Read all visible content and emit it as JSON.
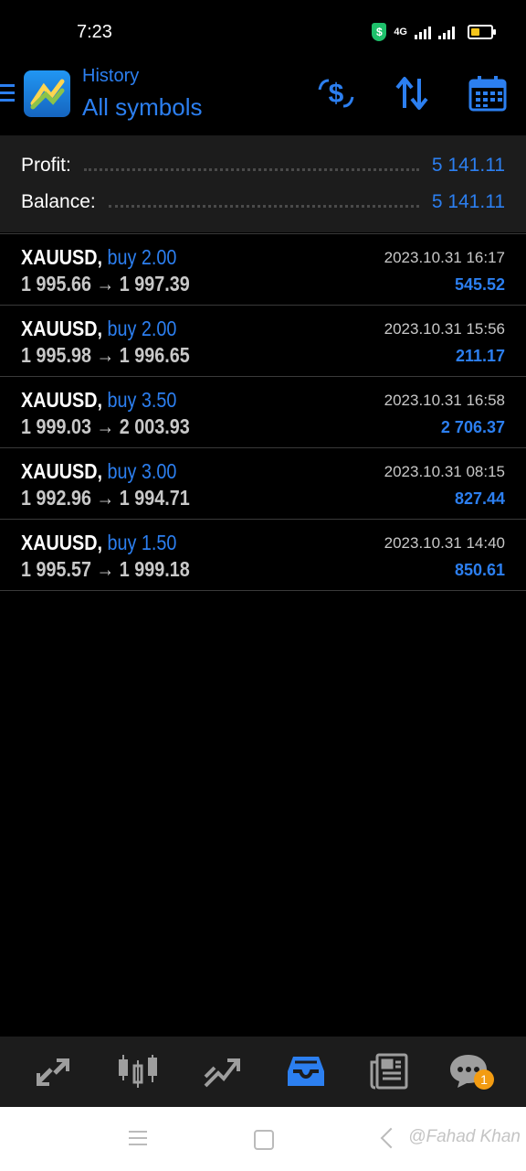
{
  "status_bar": {
    "time": "7:23",
    "network": "4G"
  },
  "header": {
    "title": "History",
    "subtitle": "All symbols"
  },
  "summary": {
    "profit_label": "Profit:",
    "profit_value": "5 141.11",
    "balance_label": "Balance:",
    "balance_value": "5 141.11"
  },
  "deals": [
    {
      "symbol": "XAUUSD,",
      "side": "buy 2.00",
      "open": "1 995.66",
      "close": "1 997.39",
      "time": "2023.10.31 16:17",
      "profit": "545.52"
    },
    {
      "symbol": "XAUUSD,",
      "side": "buy 2.00",
      "open": "1 995.98",
      "close": "1 996.65",
      "time": "2023.10.31 15:56",
      "profit": "211.17"
    },
    {
      "symbol": "XAUUSD,",
      "side": "buy 3.50",
      "open": "1 999.03",
      "close": "2 003.93",
      "time": "2023.10.31 16:58",
      "profit": "2 706.37"
    },
    {
      "symbol": "XAUUSD,",
      "side": "buy 3.00",
      "open": "1 992.96",
      "close": "1 994.71",
      "time": "2023.10.31 08:15",
      "profit": "827.44"
    },
    {
      "symbol": "XAUUSD,",
      "side": "buy 1.50",
      "open": "1 995.57",
      "close": "1 999.18",
      "time": "2023.10.31 14:40",
      "profit": "850.61"
    }
  ],
  "arrow": "→",
  "bottom_nav": {
    "chat_badge": "1"
  },
  "watermark": "@Fahad Khan",
  "colors": {
    "accent": "#2c7ff0",
    "background": "#000000",
    "panel": "#1c1c1c",
    "badge": "#f39c12"
  },
  "icons": {
    "header": [
      "dollar-exchange-icon",
      "sort-icon",
      "calendar-icon"
    ],
    "nav": [
      "quotes-icon",
      "chart-candles-icon",
      "trade-icon",
      "history-inbox-icon",
      "news-icon",
      "chat-icon"
    ]
  }
}
